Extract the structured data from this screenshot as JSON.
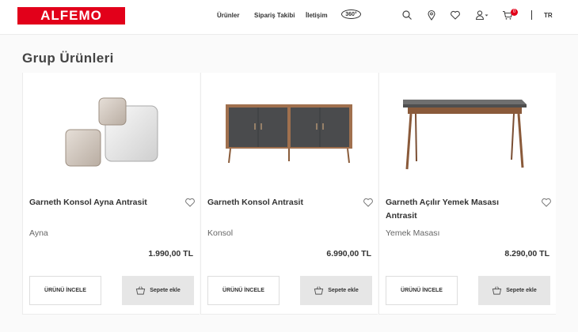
{
  "brand": {
    "name": "ALFEMO",
    "color": "#e2001a"
  },
  "nav": {
    "products": "Ürünler",
    "order_tracking": "Sipariş Takibi",
    "contact": "İletişim",
    "view360": "360°"
  },
  "header_icons": [
    "search-icon",
    "location-icon",
    "heart-icon",
    "user-icon",
    "cart-icon"
  ],
  "cart": {
    "count": "0"
  },
  "language": "TR",
  "page": {
    "title": "Grup Ürünleri"
  },
  "labels": {
    "detail_button": "ÜRÜNÜ İNCELE",
    "cart_button": "Sepete ekle"
  },
  "products": [
    {
      "name": "Garneth Konsol Ayna Antrasit",
      "category": "Ayna",
      "price": "1.990,00 TL"
    },
    {
      "name": "Garneth Konsol Antrasit",
      "category": "Konsol",
      "price": "6.990,00 TL"
    },
    {
      "name": "Garneth Açılır Yemek Masası Antrasit",
      "category": "Yemek Masası",
      "price": "8.290,00 TL"
    }
  ]
}
